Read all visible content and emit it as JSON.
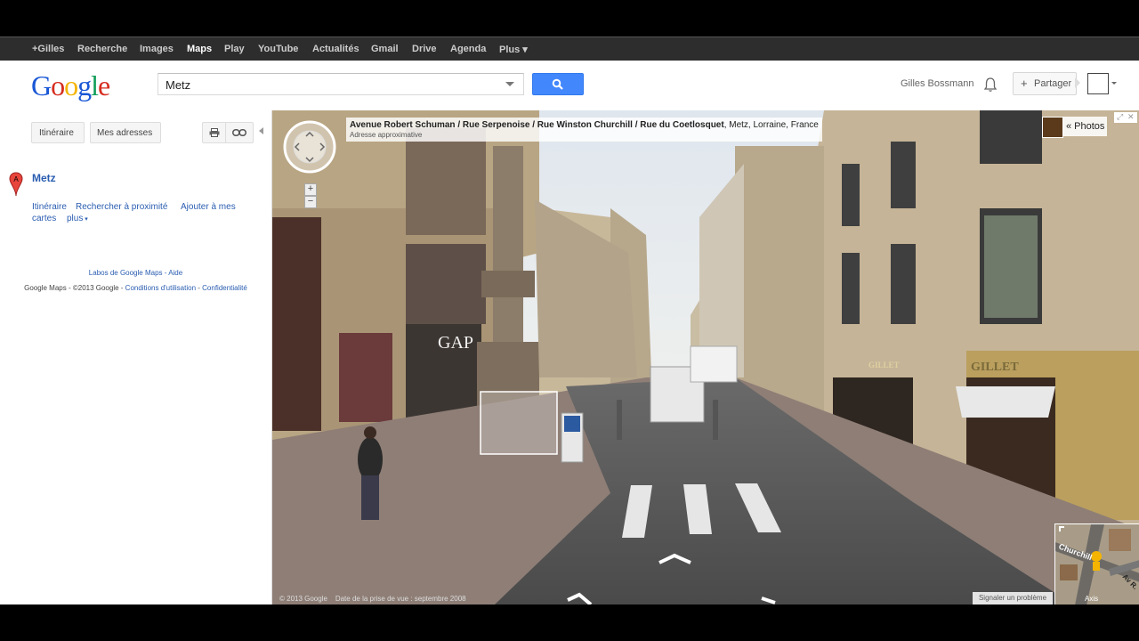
{
  "gbar": {
    "items": [
      "+Gilles",
      "Recherche",
      "Images",
      "Maps",
      "Play",
      "YouTube",
      "Actualités",
      "Gmail",
      "Drive",
      "Agenda",
      "Plus ▾"
    ],
    "active": "Maps"
  },
  "header": {
    "search_value": "Metz",
    "user_name": "Gilles Bossmann",
    "share_label": "Partager"
  },
  "sidebar": {
    "itinerary_button": "Itinéraire",
    "my_places_button": "Mes adresses",
    "place_marker": "A",
    "place_name": "Metz",
    "links": {
      "directions": "Itinéraire",
      "search_nearby": "Rechercher à proximité",
      "add_to_maps_1": "Ajouter à mes",
      "add_to_maps_2": "cartes",
      "more": "plus"
    },
    "labs_line": "Labos de Google Maps - Aide",
    "footer_prefix": "Google Maps - ©2013 Google - ",
    "terms": "Conditions d'utilisation",
    "privacy": "Confidentialité"
  },
  "streetview": {
    "address_bold": "Avenue Robert Schuman / Rue Serpenoise / Rue Winston Churchill / Rue du Coetlosquet",
    "address_rest": ", Metz, Lorraine, France",
    "address_note": "Adresse approximative",
    "photos_label": "« Photos",
    "copyright": "© 2013 Google",
    "capture_date": "Date de la prise de vue : septembre 2008",
    "report_label": "Signaler un problème",
    "store_sign_1": "GAP",
    "store_sign_2": "GILLET",
    "store_sign_3": "GILLET",
    "minimap_label": "Churchill",
    "minimap_label_2": "Axis",
    "minimap_label_3": "Av R."
  },
  "colors": {
    "accent_blue": "#4387fd",
    "link_blue": "#2a5db0",
    "gbar_bg": "#2d2d2d"
  }
}
